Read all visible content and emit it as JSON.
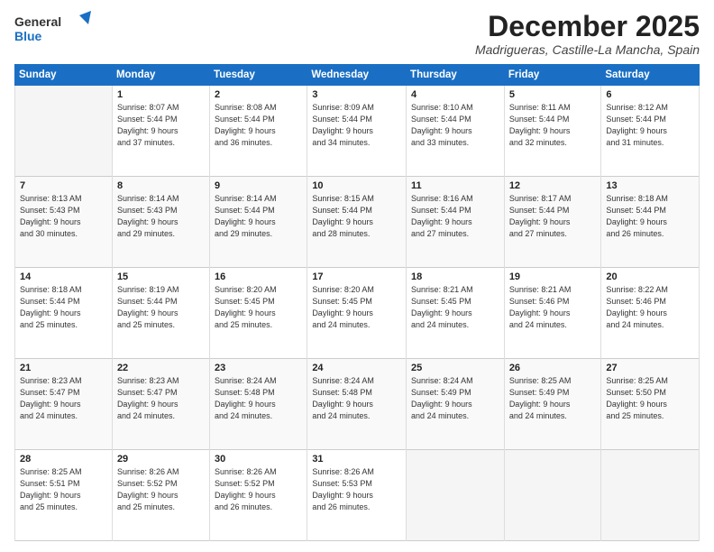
{
  "header": {
    "logo_line1": "General",
    "logo_line2": "Blue",
    "month": "December 2025",
    "location": "Madrigueras, Castille-La Mancha, Spain"
  },
  "days_of_week": [
    "Sunday",
    "Monday",
    "Tuesday",
    "Wednesday",
    "Thursday",
    "Friday",
    "Saturday"
  ],
  "weeks": [
    [
      {
        "num": "",
        "info": "",
        "empty": true
      },
      {
        "num": "1",
        "info": "Sunrise: 8:07 AM\nSunset: 5:44 PM\nDaylight: 9 hours\nand 37 minutes.",
        "empty": false
      },
      {
        "num": "2",
        "info": "Sunrise: 8:08 AM\nSunset: 5:44 PM\nDaylight: 9 hours\nand 36 minutes.",
        "empty": false
      },
      {
        "num": "3",
        "info": "Sunrise: 8:09 AM\nSunset: 5:44 PM\nDaylight: 9 hours\nand 34 minutes.",
        "empty": false
      },
      {
        "num": "4",
        "info": "Sunrise: 8:10 AM\nSunset: 5:44 PM\nDaylight: 9 hours\nand 33 minutes.",
        "empty": false
      },
      {
        "num": "5",
        "info": "Sunrise: 8:11 AM\nSunset: 5:44 PM\nDaylight: 9 hours\nand 32 minutes.",
        "empty": false
      },
      {
        "num": "6",
        "info": "Sunrise: 8:12 AM\nSunset: 5:44 PM\nDaylight: 9 hours\nand 31 minutes.",
        "empty": false
      }
    ],
    [
      {
        "num": "7",
        "info": "Sunrise: 8:13 AM\nSunset: 5:43 PM\nDaylight: 9 hours\nand 30 minutes.",
        "empty": false
      },
      {
        "num": "8",
        "info": "Sunrise: 8:14 AM\nSunset: 5:43 PM\nDaylight: 9 hours\nand 29 minutes.",
        "empty": false
      },
      {
        "num": "9",
        "info": "Sunrise: 8:14 AM\nSunset: 5:44 PM\nDaylight: 9 hours\nand 29 minutes.",
        "empty": false
      },
      {
        "num": "10",
        "info": "Sunrise: 8:15 AM\nSunset: 5:44 PM\nDaylight: 9 hours\nand 28 minutes.",
        "empty": false
      },
      {
        "num": "11",
        "info": "Sunrise: 8:16 AM\nSunset: 5:44 PM\nDaylight: 9 hours\nand 27 minutes.",
        "empty": false
      },
      {
        "num": "12",
        "info": "Sunrise: 8:17 AM\nSunset: 5:44 PM\nDaylight: 9 hours\nand 27 minutes.",
        "empty": false
      },
      {
        "num": "13",
        "info": "Sunrise: 8:18 AM\nSunset: 5:44 PM\nDaylight: 9 hours\nand 26 minutes.",
        "empty": false
      }
    ],
    [
      {
        "num": "14",
        "info": "Sunrise: 8:18 AM\nSunset: 5:44 PM\nDaylight: 9 hours\nand 25 minutes.",
        "empty": false
      },
      {
        "num": "15",
        "info": "Sunrise: 8:19 AM\nSunset: 5:44 PM\nDaylight: 9 hours\nand 25 minutes.",
        "empty": false
      },
      {
        "num": "16",
        "info": "Sunrise: 8:20 AM\nSunset: 5:45 PM\nDaylight: 9 hours\nand 25 minutes.",
        "empty": false
      },
      {
        "num": "17",
        "info": "Sunrise: 8:20 AM\nSunset: 5:45 PM\nDaylight: 9 hours\nand 24 minutes.",
        "empty": false
      },
      {
        "num": "18",
        "info": "Sunrise: 8:21 AM\nSunset: 5:45 PM\nDaylight: 9 hours\nand 24 minutes.",
        "empty": false
      },
      {
        "num": "19",
        "info": "Sunrise: 8:21 AM\nSunset: 5:46 PM\nDaylight: 9 hours\nand 24 minutes.",
        "empty": false
      },
      {
        "num": "20",
        "info": "Sunrise: 8:22 AM\nSunset: 5:46 PM\nDaylight: 9 hours\nand 24 minutes.",
        "empty": false
      }
    ],
    [
      {
        "num": "21",
        "info": "Sunrise: 8:23 AM\nSunset: 5:47 PM\nDaylight: 9 hours\nand 24 minutes.",
        "empty": false
      },
      {
        "num": "22",
        "info": "Sunrise: 8:23 AM\nSunset: 5:47 PM\nDaylight: 9 hours\nand 24 minutes.",
        "empty": false
      },
      {
        "num": "23",
        "info": "Sunrise: 8:24 AM\nSunset: 5:48 PM\nDaylight: 9 hours\nand 24 minutes.",
        "empty": false
      },
      {
        "num": "24",
        "info": "Sunrise: 8:24 AM\nSunset: 5:48 PM\nDaylight: 9 hours\nand 24 minutes.",
        "empty": false
      },
      {
        "num": "25",
        "info": "Sunrise: 8:24 AM\nSunset: 5:49 PM\nDaylight: 9 hours\nand 24 minutes.",
        "empty": false
      },
      {
        "num": "26",
        "info": "Sunrise: 8:25 AM\nSunset: 5:49 PM\nDaylight: 9 hours\nand 24 minutes.",
        "empty": false
      },
      {
        "num": "27",
        "info": "Sunrise: 8:25 AM\nSunset: 5:50 PM\nDaylight: 9 hours\nand 25 minutes.",
        "empty": false
      }
    ],
    [
      {
        "num": "28",
        "info": "Sunrise: 8:25 AM\nSunset: 5:51 PM\nDaylight: 9 hours\nand 25 minutes.",
        "empty": false
      },
      {
        "num": "29",
        "info": "Sunrise: 8:26 AM\nSunset: 5:52 PM\nDaylight: 9 hours\nand 25 minutes.",
        "empty": false
      },
      {
        "num": "30",
        "info": "Sunrise: 8:26 AM\nSunset: 5:52 PM\nDaylight: 9 hours\nand 26 minutes.",
        "empty": false
      },
      {
        "num": "31",
        "info": "Sunrise: 8:26 AM\nSunset: 5:53 PM\nDaylight: 9 hours\nand 26 minutes.",
        "empty": false
      },
      {
        "num": "",
        "info": "",
        "empty": true
      },
      {
        "num": "",
        "info": "",
        "empty": true
      },
      {
        "num": "",
        "info": "",
        "empty": true
      }
    ]
  ]
}
